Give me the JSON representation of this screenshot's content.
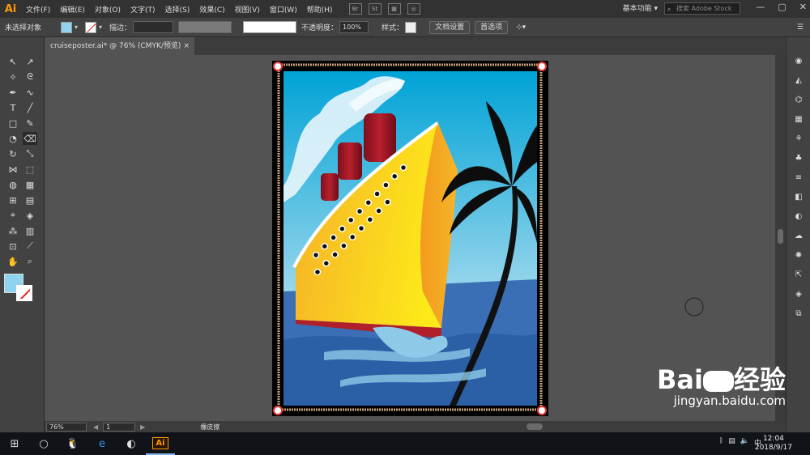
{
  "app": {
    "logo": "Ai",
    "menus": [
      "文件(F)",
      "编辑(E)",
      "对象(O)",
      "文字(T)",
      "选择(S)",
      "效果(C)",
      "视图(V)",
      "窗口(W)",
      "帮助(H)"
    ],
    "bridge": "Br",
    "stock": "St",
    "workspace": "基本功能",
    "search_placeholder": "搜索 Adobe Stock"
  },
  "control": {
    "no_selection": "未选择对象",
    "fill_color": "#8fd3ee",
    "stroke_label": "描边：",
    "opacity_label": "不透明度：",
    "opacity_value": "100%",
    "style_label": "样式：",
    "doc_setup": "文档设置",
    "preferences": "首选项"
  },
  "tab": {
    "title": "cruiseposter.ai* @ 76% (CMYK/预览)",
    "close": "×"
  },
  "status": {
    "zoom": "76%",
    "page": "1",
    "tool": "橡皮擦"
  },
  "taskbar": {
    "time": "12:04",
    "date": "2018/9/17",
    "ime": "中",
    "ai_icon": "Ai"
  },
  "watermark": {
    "brand": "Bai",
    "brand2": "经验",
    "url": "jingyan.baidu.com"
  },
  "colors": {
    "accent": "#ff9a00",
    "sky": "#00a8d8",
    "hull": "#f7c21c",
    "sea": "#3a6fb5"
  }
}
